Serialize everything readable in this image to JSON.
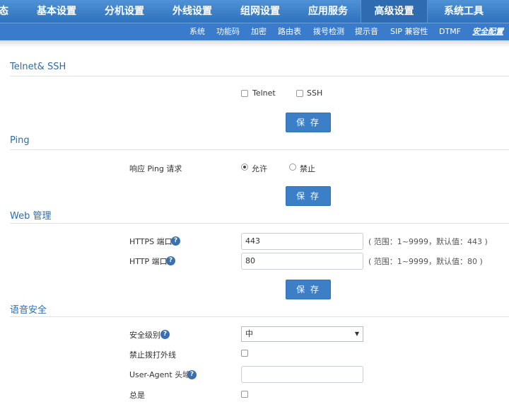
{
  "topnav": {
    "tabs": [
      "态",
      "基本设置",
      "分机设置",
      "外线设置",
      "组网设置",
      "应用服务",
      "高级设置",
      "系统工具"
    ]
  },
  "subnav": {
    "items": [
      "系统",
      "功能码",
      "加密",
      "路由表",
      "拨号检测",
      "提示音",
      "SIP 兼容性",
      "DTMF",
      "安全配置"
    ]
  },
  "telnet_ssh": {
    "title": "Telnet& SSH",
    "telnet_label": "Telnet",
    "ssh_label": "SSH",
    "save_label": "保 存"
  },
  "ping": {
    "title": "Ping",
    "respond_label": "响应 Ping 请求",
    "allow_label": "允许",
    "deny_label": "禁止",
    "save_label": "保 存"
  },
  "web": {
    "title": "Web 管理",
    "https_label": "HTTPS 端口",
    "https_value": "443",
    "https_hint": "( 范围：1~9999，默认值：443 )",
    "http_label": "HTTP 端口",
    "http_value": "80",
    "http_hint": "( 范围：1~9999，默认值：80 )",
    "save_label": "保 存"
  },
  "voice": {
    "title": "语音安全",
    "level_label": "安全级别",
    "level_value": "中",
    "block_outbound_label": "禁止拨打外线",
    "ua_label": "User-Agent 头域",
    "ua_value": "",
    "always_label": "总是"
  },
  "icons": {
    "help": "?",
    "arrow": "▼"
  }
}
